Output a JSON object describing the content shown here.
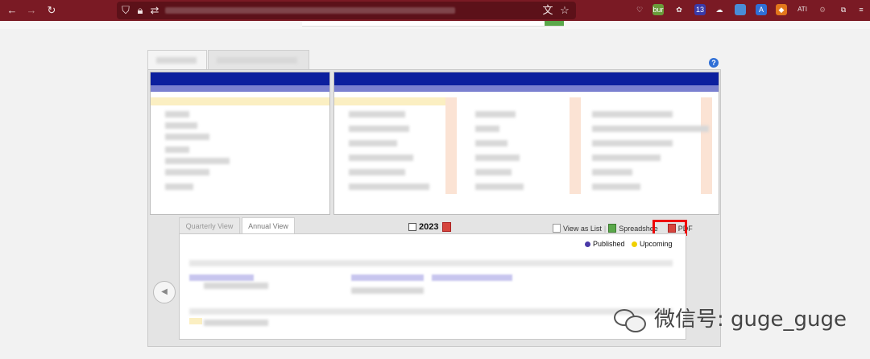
{
  "browser": {
    "back_icon": "arrow-left-icon",
    "forward_icon": "arrow-right-icon",
    "reload_icon": "reload-icon",
    "extensions": [
      {
        "name": "pocket-icon",
        "label": ""
      },
      {
        "name": "bur-extension-icon",
        "label": "bur"
      },
      {
        "name": "extension-icon",
        "label": ""
      },
      {
        "name": "badge-extension-icon",
        "label": "13"
      },
      {
        "name": "cloud-icon",
        "label": ""
      },
      {
        "name": "extension-icon",
        "label": ""
      },
      {
        "name": "translate-icon",
        "label": ""
      },
      {
        "name": "metamask-icon",
        "label": ""
      },
      {
        "name": "extension-icon",
        "label": "ATI"
      },
      {
        "name": "extension-icon",
        "label": ""
      },
      {
        "name": "puzzle-icon",
        "label": ""
      },
      {
        "name": "menu-icon",
        "label": ""
      }
    ]
  },
  "page": {
    "help_label": "?",
    "year": "2023",
    "subtabs": [
      "Quarterly View",
      "Annual View"
    ],
    "actions": {
      "view_as_list": "View as List",
      "spreadsheet": "Spreadshee",
      "pdf": "PDF"
    },
    "legend": {
      "published": "Published",
      "upcoming": "Upcoming"
    },
    "colors": {
      "published": "#4a3aa8",
      "upcoming": "#f0d000",
      "header_blue": "#0c1f9e",
      "highlight_red": "#e00000"
    }
  },
  "watermark": {
    "text": "微信号: guge_guge"
  }
}
